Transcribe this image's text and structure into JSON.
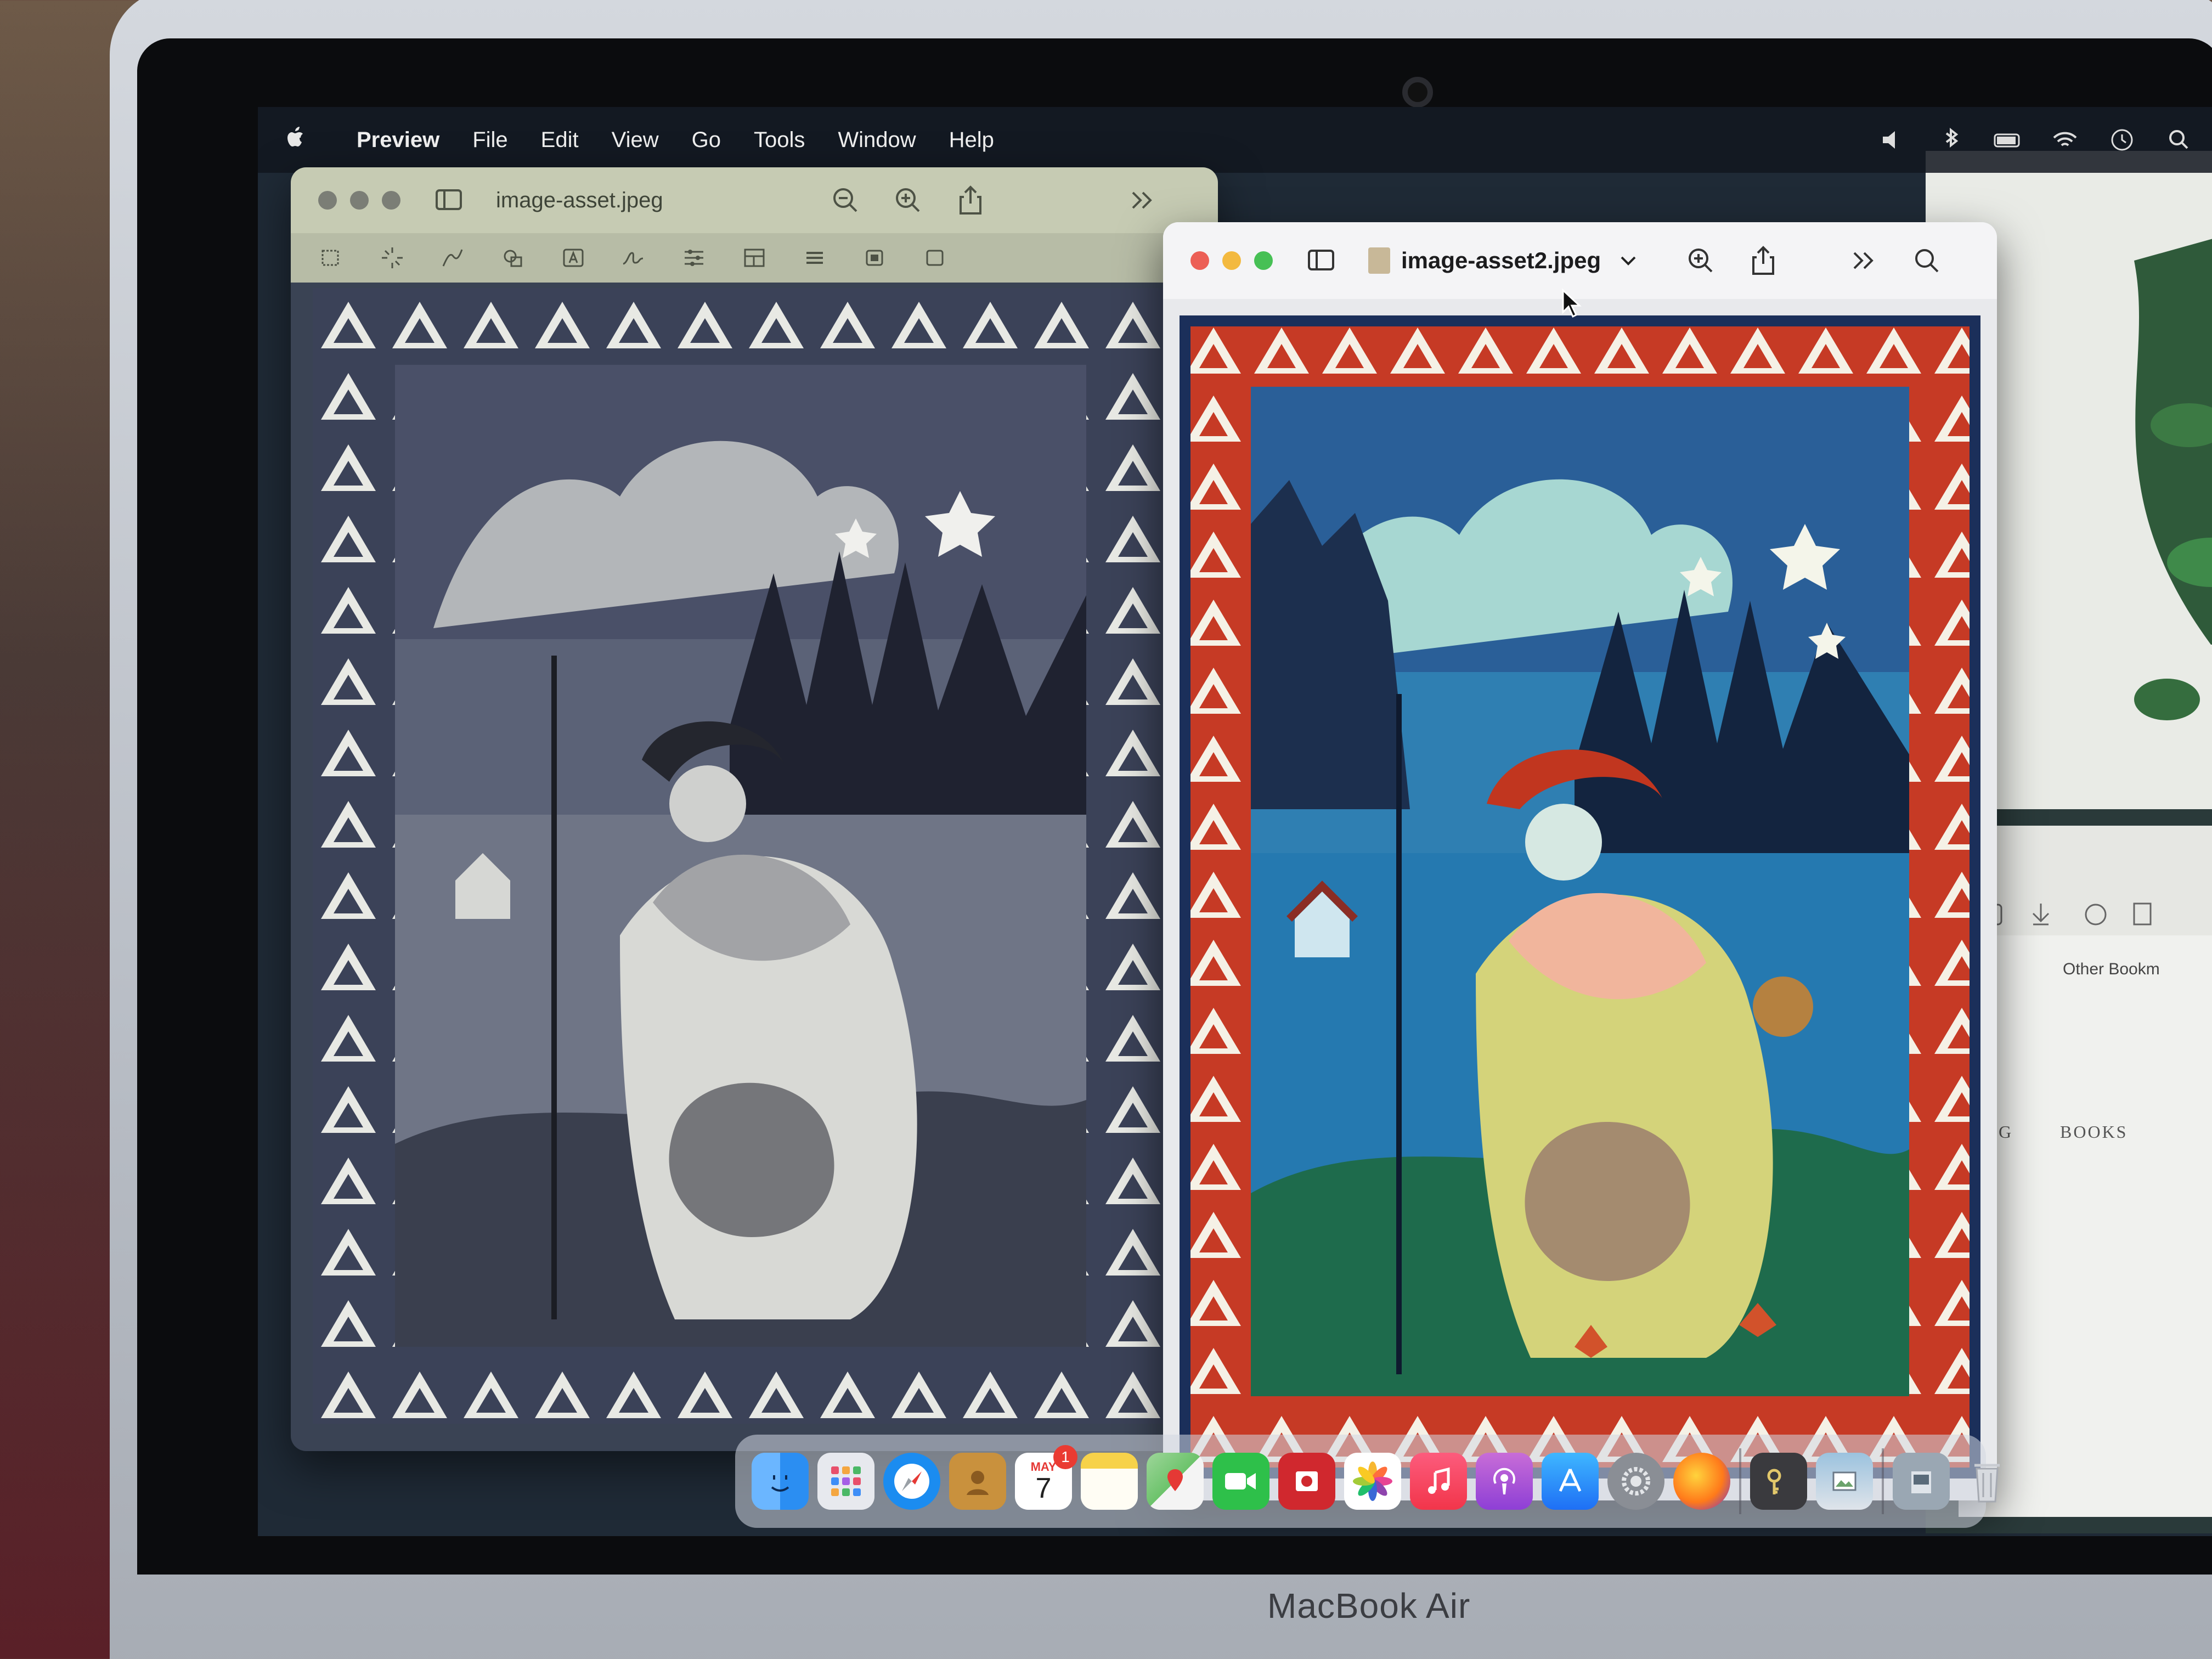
{
  "device": {
    "brand": "MacBook Air"
  },
  "menubar": {
    "app_name": "Preview",
    "items": [
      "File",
      "Edit",
      "View",
      "Go",
      "Tools",
      "Window",
      "Help"
    ]
  },
  "window_left": {
    "title": "image-asset.jpeg",
    "state": "inactive",
    "view_mode": "grayscale"
  },
  "window_right": {
    "title": "image-asset2.jpeg",
    "state": "active",
    "view_mode": "color"
  },
  "browser_behind": {
    "bookmarks_label": "Other Bookm",
    "nav_links": [
      "BLOG",
      "BOOKS"
    ]
  },
  "dock": {
    "apps": [
      {
        "name": "Finder",
        "icon": "finder-icon",
        "color": "#2b8ef2"
      },
      {
        "name": "Launchpad",
        "icon": "launchpad-icon",
        "color": "#e7e9ee"
      },
      {
        "name": "Safari",
        "icon": "safari-icon",
        "color": "#1b8cf0"
      },
      {
        "name": "Contacts",
        "icon": "contacts-icon",
        "color": "#c9913d"
      },
      {
        "name": "Calendar",
        "icon": "calendar-icon",
        "color": "#ffffff",
        "month": "MAY",
        "day": "7",
        "badge": "1"
      },
      {
        "name": "Notes",
        "icon": "notes-icon",
        "color": "#f7d24a"
      },
      {
        "name": "Maps",
        "icon": "maps-icon",
        "color": "#6cc36b"
      },
      {
        "name": "FaceTime",
        "icon": "facetime-icon",
        "color": "#2ec04a"
      },
      {
        "name": "Photo Booth",
        "icon": "photobooth-icon",
        "color": "#d0282e"
      },
      {
        "name": "Photos",
        "icon": "photos-icon",
        "color": "#ffffff"
      },
      {
        "name": "Music",
        "icon": "music-icon",
        "color": "#f2354a"
      },
      {
        "name": "Podcasts",
        "icon": "podcasts-icon",
        "color": "#a94fe0"
      },
      {
        "name": "App Store",
        "icon": "appstore-icon",
        "color": "#1e8cf5"
      },
      {
        "name": "System Settings",
        "icon": "settings-icon",
        "color": "#8a8e95"
      },
      {
        "name": "Firefox",
        "icon": "firefox-icon",
        "color": "#ff7a1a"
      },
      {
        "name": "Keychain Access",
        "icon": "keychain-icon",
        "color": "#3a3a3e"
      },
      {
        "name": "Preview",
        "icon": "preview-icon",
        "color": "#dfe4ea"
      },
      {
        "name": "Downloads Stack",
        "icon": "stack-icon",
        "color": "#9aa7b3"
      },
      {
        "name": "Trash",
        "icon": "trash-icon",
        "color": "#c9ccd2"
      }
    ]
  },
  "colors": {
    "accent_red": "#c63a25",
    "sky_blue": "#2f7fb2",
    "dress_yellow": "#d4d37a"
  }
}
